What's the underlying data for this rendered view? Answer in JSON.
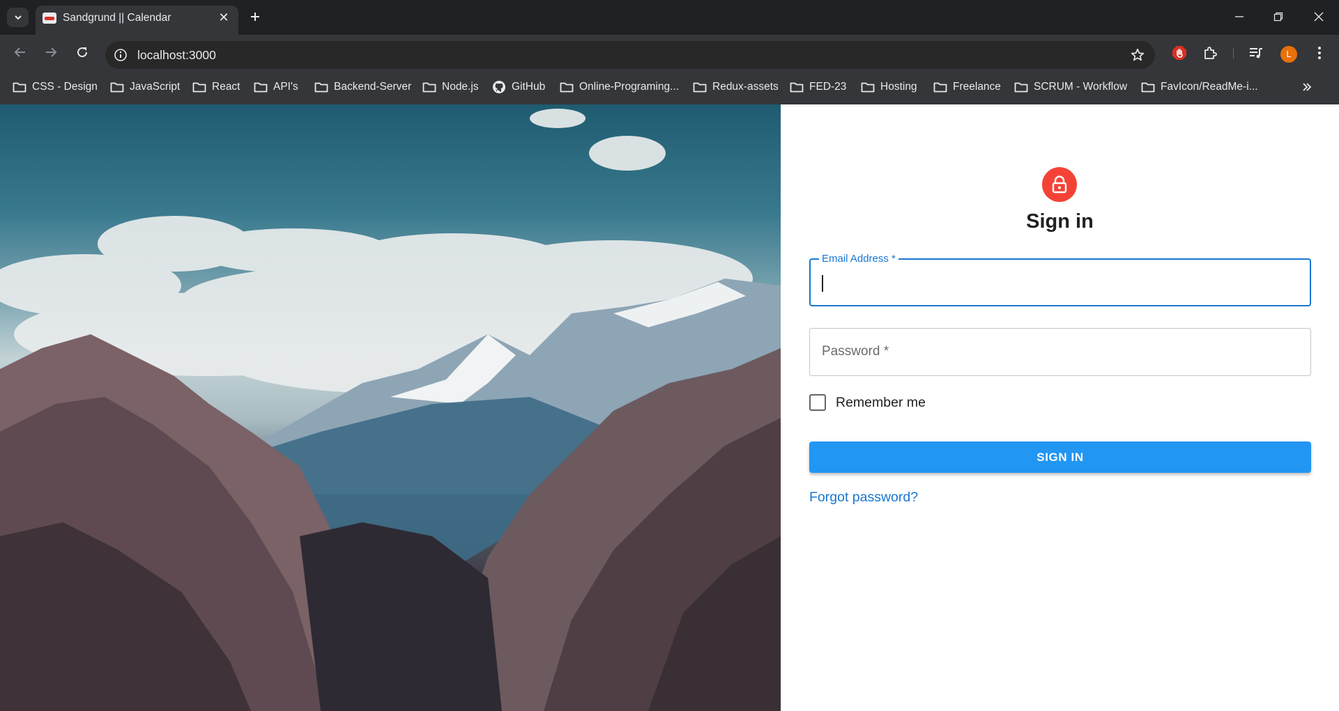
{
  "browser": {
    "tab": {
      "title": "Sandgrund || Calendar"
    },
    "url": "localhost:3000",
    "profile_initial": "L",
    "bookmarks": [
      {
        "label": "CSS - Design",
        "icon": "folder-icon"
      },
      {
        "label": "JavaScript",
        "icon": "folder-icon"
      },
      {
        "label": "React",
        "icon": "folder-icon"
      },
      {
        "label": "API's",
        "icon": "folder-icon"
      },
      {
        "label": "Backend-Server",
        "icon": "folder-icon"
      },
      {
        "label": "Node.js",
        "icon": "folder-icon"
      },
      {
        "label": "GitHub",
        "icon": "github-icon"
      },
      {
        "label": "Online-Programing...",
        "icon": "folder-icon"
      },
      {
        "label": "Redux-assets",
        "icon": "folder-icon"
      },
      {
        "label": "FED-23",
        "icon": "folder-icon"
      },
      {
        "label": "Hosting",
        "icon": "folder-icon"
      },
      {
        "label": "Freelance",
        "icon": "folder-icon"
      },
      {
        "label": "SCRUM - Workflow",
        "icon": "folder-icon"
      },
      {
        "label": "FavIcon/ReadMe-i...",
        "icon": "folder-icon"
      }
    ]
  },
  "login": {
    "heading": "Sign in",
    "email_label": "Email Address *",
    "email_value": "",
    "password_placeholder": "Password *",
    "remember_label": "Remember me",
    "remember_checked": false,
    "submit_label": "SIGN IN",
    "forgot_link": "Forgot password?"
  },
  "colors": {
    "accent": "#1976d2",
    "button": "#2196f3",
    "lock_avatar": "#f44336"
  }
}
